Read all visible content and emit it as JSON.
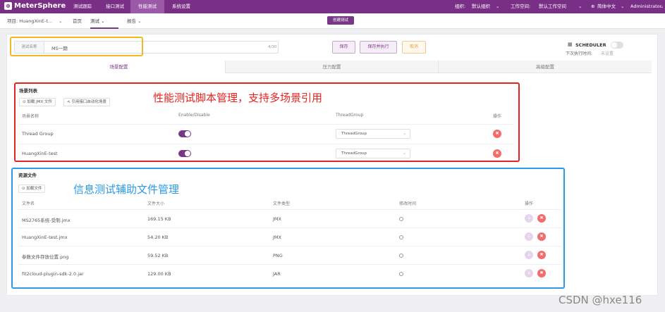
{
  "topbar": {
    "logo": "MeterSphere",
    "nav": [
      "测试跟踪",
      "接口测试",
      "性能测试",
      "系统设置"
    ],
    "org_label": "组织:",
    "org_value": "默认组织",
    "ws_label": "工作空间:",
    "ws_value": "默认工作空间",
    "language": "简体中文",
    "user": "Administrator"
  },
  "subbar": {
    "project": "项目: HuangXinE-t...",
    "items": [
      "首页",
      "测试",
      "报告"
    ],
    "create_button": "创建测试"
  },
  "test": {
    "name_label": "测试名称",
    "name_value": "MS一期",
    "char_count": "4/30",
    "save": "保存",
    "save_run": "保存并执行",
    "cancel": "取消",
    "scheduler": "SCHEDULER",
    "next_exec_label": "下次执行时间:",
    "next_exec_value": "未设置"
  },
  "tabs": [
    "场景配置",
    "压力配置",
    "高级配置"
  ],
  "scenarios": {
    "title": "场景列表",
    "load_jmx": "加载 JMX 文件",
    "ref_api": "引用接口自动化场景",
    "headers": [
      "场景名称",
      "Enable/Disable",
      "ThreadGroup",
      "操作"
    ],
    "rows": [
      {
        "name": "Thread Group",
        "enabled": true,
        "threadgroup": "ThreadGroup"
      },
      {
        "name": "HuangXinE-test",
        "enabled": true,
        "threadgroup": "ThreadGroup"
      }
    ]
  },
  "files": {
    "title": "资源文件",
    "load_file": "加载文件",
    "headers": [
      "文件名",
      "文件大小",
      "文件类型",
      "修改时间",
      "操作"
    ],
    "rows": [
      {
        "name": "MS2765系统-受制.jmx",
        "size": "169.15 KB",
        "type": "JMX"
      },
      {
        "name": "HuangXinE-test.jmx",
        "size": "54.20 KB",
        "type": "JMX"
      },
      {
        "name": "参数文件存放位置.png",
        "size": "59.52 KB",
        "type": "PNG"
      },
      {
        "name": "fit2cloud-plugin-sdk-2.0.jar",
        "size": "129.00 KB",
        "type": "JAR"
      }
    ]
  },
  "annotations": {
    "red": "性能测试脚本管理，支持多场景引用",
    "blue": "信息测试辅助文件管理"
  },
  "watermark": "CSDN @hxe116",
  "colors": {
    "brand": "#783887",
    "danger": "#f56c6c",
    "red_annot": "#e5221f",
    "blue_annot": "#2b9ae8",
    "yellow_annot": "#f5b722"
  }
}
